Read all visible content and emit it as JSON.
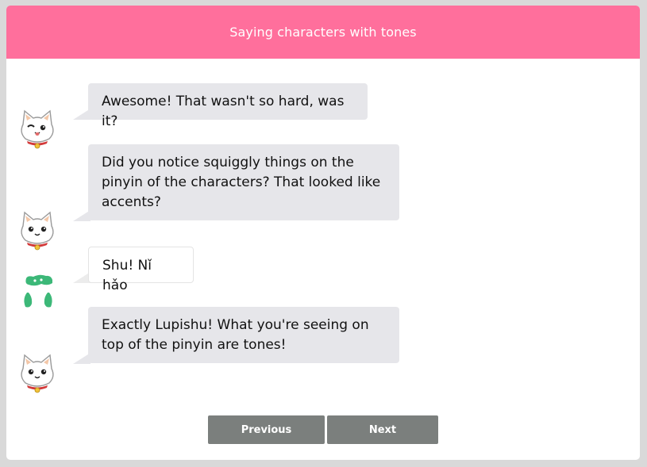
{
  "header": {
    "title": "Saying characters with tones"
  },
  "messages": [
    {
      "sender": "bot",
      "avatar_icon": "cat-wink-icon",
      "text": "Awesome! That wasn't so hard, was it?"
    },
    {
      "sender": "bot",
      "avatar_icon": "cat-icon",
      "text": "Did you notice squiggly things on the pinyin of the characters? That looked like accents?"
    },
    {
      "sender": "user",
      "avatar_icon": "green-blob-avatar-icon",
      "text": "Shu! Nǐ hǎo"
    },
    {
      "sender": "bot",
      "avatar_icon": "cat-icon",
      "text": "Exactly Lupishu! What you're seeing on top of the pinyin are tones!"
    }
  ],
  "nav": {
    "previous_label": "Previous",
    "next_label": "Next"
  },
  "colors": {
    "header": "#ff6f9c",
    "bot_bubble": "#e6e6ea",
    "button": "#7b7f7d",
    "user_avatar": "#3cb878"
  }
}
